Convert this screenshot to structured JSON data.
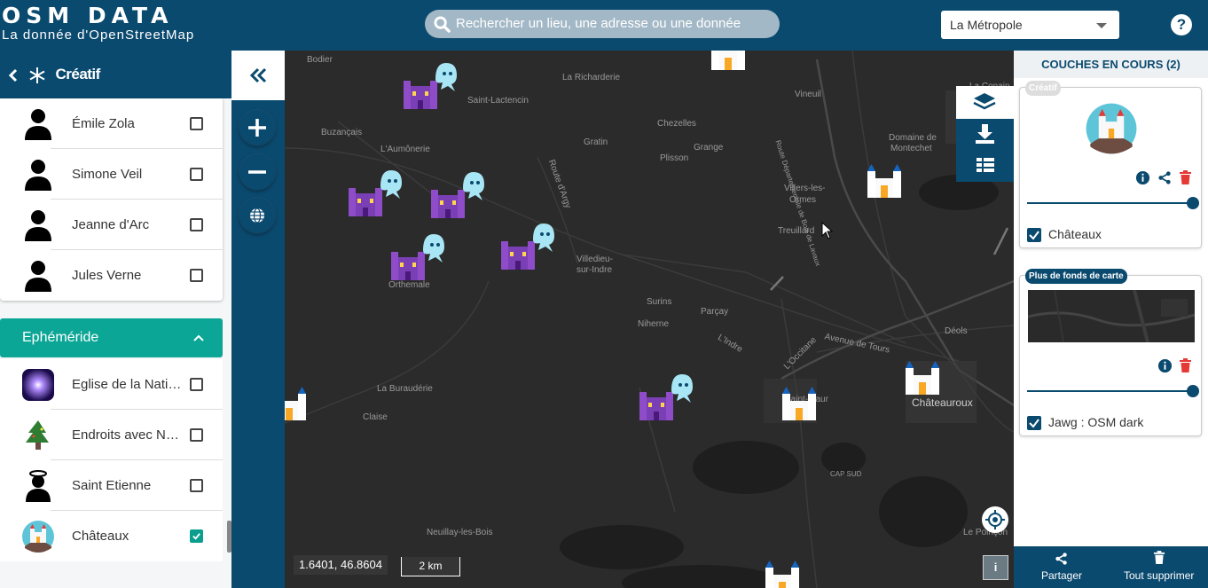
{
  "header": {
    "logo_line1": "OSM DATA",
    "logo_line2": "La donnée d'OpenStreetMap",
    "search_placeholder": "Rechercher un lieu, une adresse ou une donnée",
    "territory": "La Métropole",
    "help": "?"
  },
  "sidebar": {
    "title": "Créatif",
    "people": [
      {
        "label": "Émile Zola",
        "checked": false
      },
      {
        "label": "Simone Veil",
        "checked": false
      },
      {
        "label": "Jeanne d'Arc",
        "checked": false
      },
      {
        "label": "Jules Verne",
        "checked": false
      }
    ],
    "section": "Ephéméride",
    "ephemeride": [
      {
        "label": "Eglise de la Nati…",
        "checked": false,
        "icon": "starburst-icon"
      },
      {
        "label": "Endroits avec N…",
        "checked": false,
        "icon": "tree-icon"
      },
      {
        "label": "Saint Etienne",
        "checked": false,
        "icon": "saint-icon"
      },
      {
        "label": "Châteaux",
        "checked": true,
        "icon": "castle-icon"
      }
    ]
  },
  "map": {
    "coords": "1.6401, 46.8604",
    "scale": "2 km",
    "info": "i",
    "labels": [
      "Bodier",
      "Saint-Lactencin",
      "La Richarderie",
      "Vineuil",
      "La Conain",
      "Buzançais",
      "Gratin",
      "Chezelles",
      "Grange",
      "Plisson",
      "Domaine de",
      "Montechet",
      "L'Aumônerie",
      "Route d'Argy",
      "Villers-les-",
      "Ormes",
      "Treuillard",
      "Villedieu-",
      "sur-Indre",
      "Orthemale",
      "Surins",
      "Parçay",
      "Niherne",
      "Avenue de Tours",
      "L'Occitane",
      "Déols",
      "La Buraudérie",
      "Saint-Maur",
      "Châteauroux",
      "Claise",
      "CAP SUD",
      "Neuillay-les-Bois",
      "Le Poinçon",
      "L'Indre",
      "Route Départementale de Bois de Lavaux"
    ]
  },
  "layers": {
    "title": "COUCHES EN COURS (2)",
    "layer1": {
      "badge": "Créatif",
      "checkbox_label": "Châteaux",
      "opacity_percent": 100
    },
    "layer2": {
      "badge": "Plus de fonds de carte",
      "checkbox_label": "Jawg : OSM dark",
      "opacity_percent": 100
    },
    "share": "Partager",
    "delete_all": "Tout supprimer"
  },
  "colors": {
    "primary": "#0b4a6f",
    "accent": "#0ba696",
    "map_bg": "#2b2b2b",
    "delete": "#e53935"
  }
}
